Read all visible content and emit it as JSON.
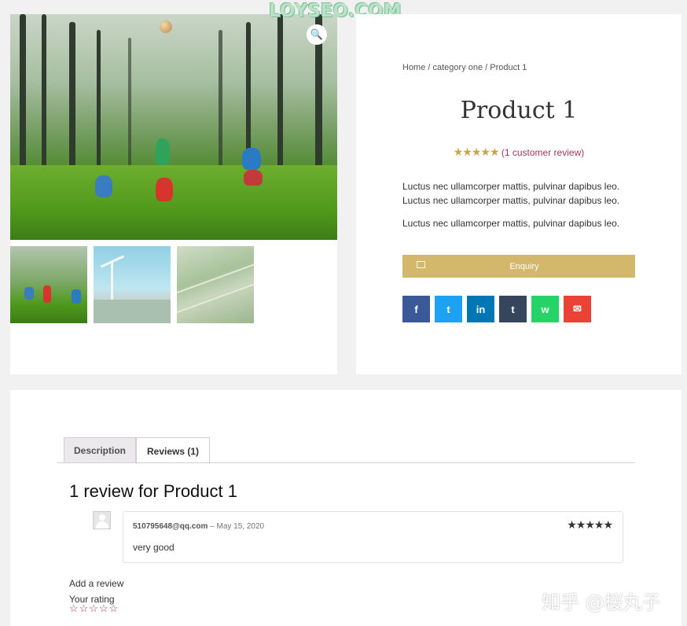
{
  "watermark": "LOYSEO.COM",
  "breadcrumb": "Home / category one / Product 1",
  "product": {
    "title": "Product 1",
    "rating_stars": "★★★★★",
    "review_link": "(1 customer review)",
    "short_description": [
      "Luctus nec ullamcorper mattis, pulvinar dapibus leo.",
      "Luctus nec ullamcorper mattis, pulvinar dapibus leo.",
      "Luctus nec ullamcorper mattis, pulvinar dapibus leo."
    ],
    "enquiry_label": "Enquiry"
  },
  "share_buttons": [
    {
      "name": "facebook",
      "glyph": "f",
      "color": "#3b5998"
    },
    {
      "name": "twitter",
      "glyph": "t",
      "color": "#1da1f2"
    },
    {
      "name": "linkedin",
      "glyph": "in",
      "color": "#0077b5"
    },
    {
      "name": "tumblr",
      "glyph": "t",
      "color": "#35465c"
    },
    {
      "name": "whatsapp",
      "glyph": "w",
      "color": "#25d366"
    },
    {
      "name": "email",
      "glyph": "✉",
      "color": "#ea4335"
    }
  ],
  "tabs": [
    {
      "label": "Description",
      "active": false
    },
    {
      "label": "Reviews (1)",
      "active": true
    }
  ],
  "reviews": {
    "title": "1 review for Product 1",
    "items": [
      {
        "author": "510795648@qq.com",
        "separator": " – ",
        "date": "May 15, 2020",
        "stars": "★★★★★",
        "text": "very good"
      }
    ],
    "add_review_label": "Add a review",
    "your_rating_label": "Your rating",
    "rating_input": "☆☆☆☆☆"
  },
  "corner_watermark": "知乎 @桜丸子"
}
